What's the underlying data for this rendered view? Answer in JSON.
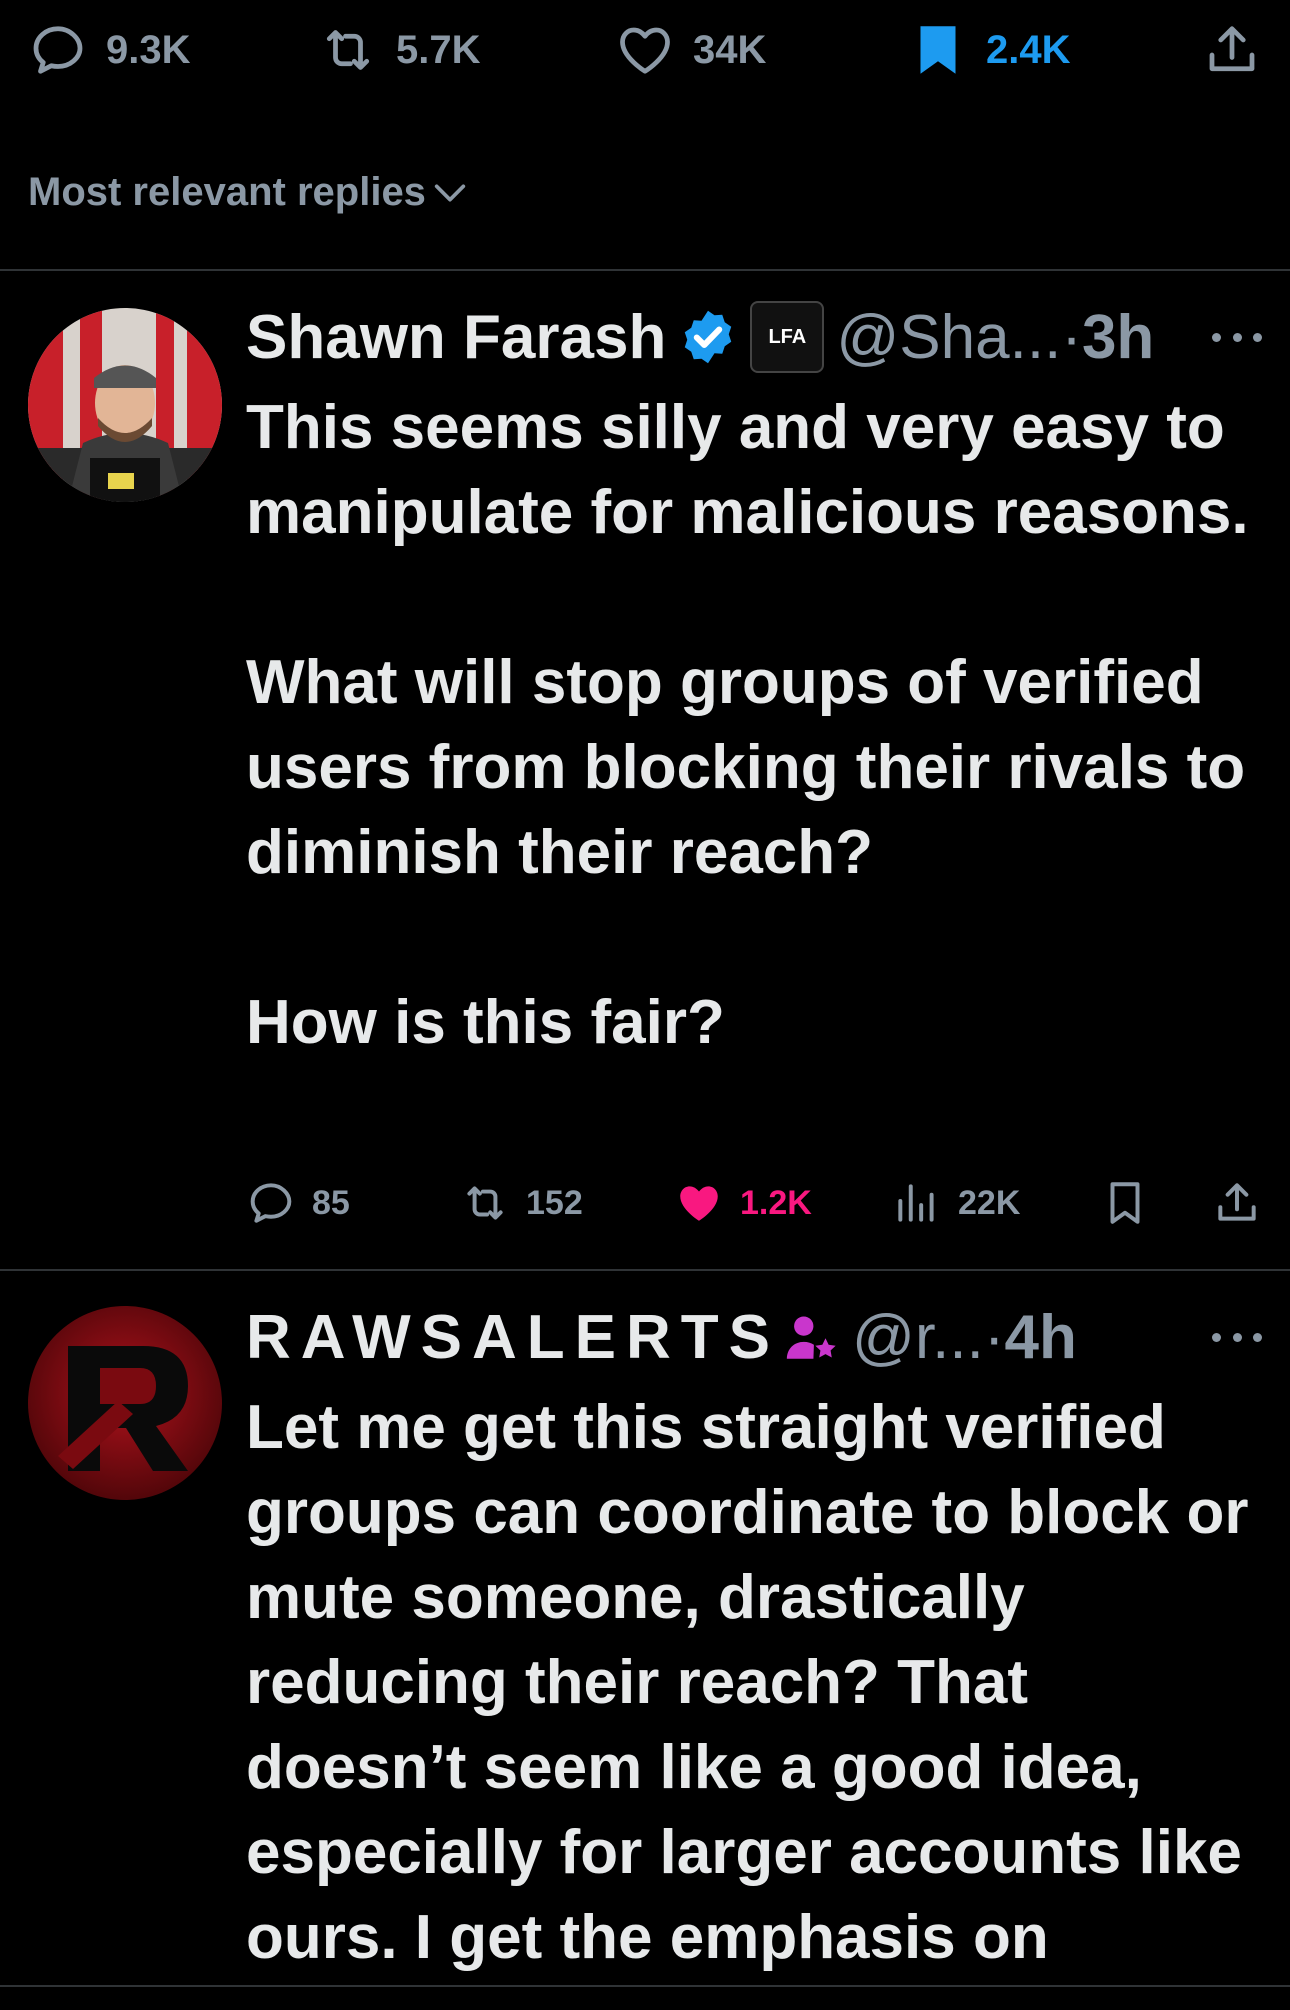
{
  "stats": {
    "replies": "9.3K",
    "reposts": "5.7K",
    "likes": "34K",
    "bookmarks": "2.4K"
  },
  "sort": {
    "label": "Most relevant replies"
  },
  "replies": [
    {
      "name": "Shawn Farash",
      "badge_text": "LFA",
      "handle": "@Sha...",
      "dot": "·",
      "time": "3h",
      "paragraphs": [
        "This seems silly and very easy to manipulate for malicious reasons.",
        "What will stop groups of verified users from blocking their rivals to diminish their reach?",
        "How is this fair?"
      ],
      "replies": "85",
      "reposts": "152",
      "likes": "1.2K",
      "views": "22K"
    },
    {
      "name": "RAWSALERTS",
      "handle": "@r...",
      "dot": "·",
      "time": "4h",
      "paragraphs": [
        "Let me get this straight verified groups can coordinate to block or mute someone, drastically reducing their reach? That doesn’t seem like a good idea, especially for larger accounts like ours. I get the emphasis on"
      ]
    }
  ],
  "colors": {
    "background": "#000000",
    "text": "#e7e9ea",
    "muted": "#8b98a5",
    "accent_blue": "#1d9bf0",
    "like_pink": "#f91880",
    "subscriber_purple": "#c936cc"
  },
  "icons": [
    "reply-icon",
    "repost-icon",
    "like-icon",
    "bookmark-icon",
    "share-icon",
    "chevron-down-icon",
    "verified-badge-icon",
    "views-icon",
    "subscriber-icon",
    "more-icon"
  ]
}
